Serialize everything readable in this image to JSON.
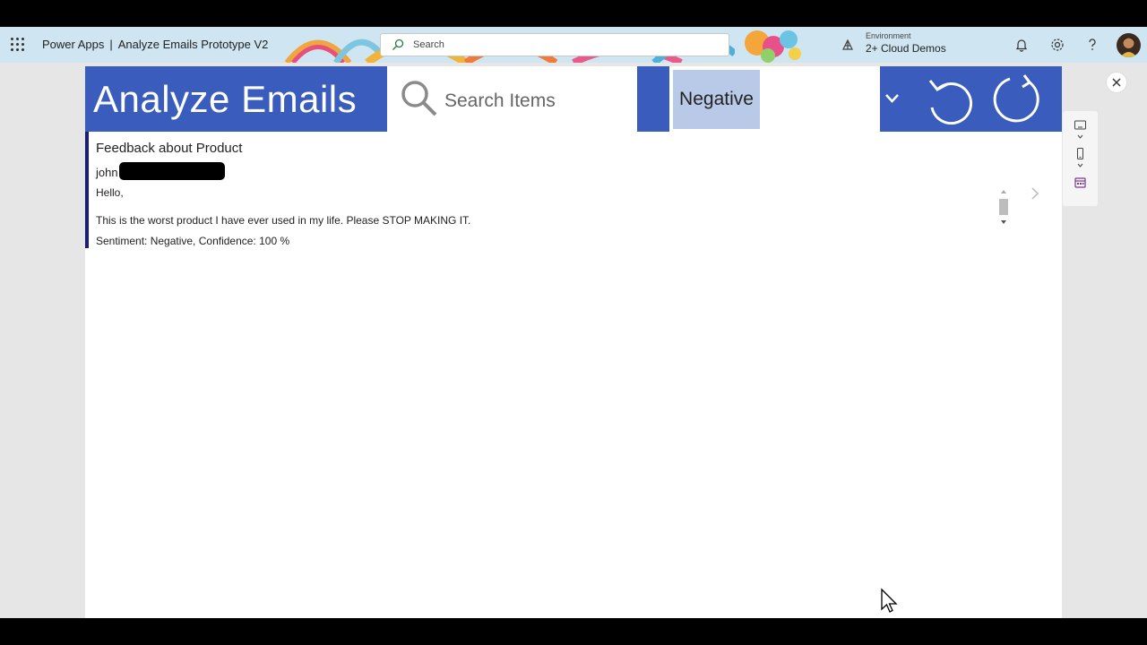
{
  "topbar": {
    "app_name": "Power Apps",
    "separator": "|",
    "app_title": "Analyze Emails Prototype V2",
    "search_placeholder": "Search",
    "environment_label": "Environment",
    "environment_name": "2+ Cloud Demos"
  },
  "app": {
    "title": "Analyze Emails",
    "search_placeholder": "Search Items",
    "filter_value": "Negative"
  },
  "email": {
    "subject": "Feedback about Product",
    "sender_visible": "john",
    "greeting": "Hello,",
    "body": "This is the worst product I have ever used in my life. Please STOP MAKING IT.",
    "sentiment": "Sentiment: Negative, Confidence: 100 %"
  },
  "colors": {
    "header_blue": "#3a5dbd",
    "selected_bg": "#b9c9e8",
    "accent_border": "#1b1b7a",
    "topbar_bg": "#cfe6f2"
  },
  "icons": [
    "waffle-icon",
    "search-icon",
    "environment-icon",
    "bell-icon",
    "gear-icon",
    "help-icon",
    "magnifier-icon",
    "chevron-down-icon",
    "undo-icon",
    "refresh-icon",
    "chevron-right-icon",
    "close-icon",
    "tablet-icon",
    "phone-icon",
    "calendar-icon"
  ]
}
